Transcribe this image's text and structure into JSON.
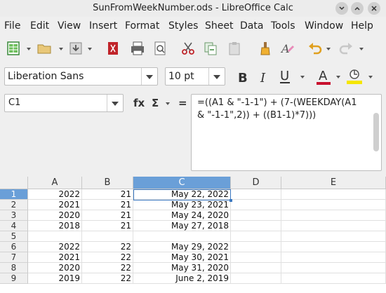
{
  "window": {
    "title": "SunFromWeekNumber.ods - LibreOffice Calc"
  },
  "menu": [
    "File",
    "Edit",
    "View",
    "Insert",
    "Format",
    "Styles",
    "Sheet",
    "Data",
    "Tools",
    "Window",
    "Help"
  ],
  "format": {
    "font_name": "Liberation Sans",
    "font_size": "10 pt"
  },
  "formula_bar": {
    "name_box": "C1",
    "fx_label": "fx",
    "sum_label": "Σ",
    "equals_label": "=",
    "formula": "=((A1 & \"-1-1\") + (7-(WEEKDAY(A1 & \"-1-1\",2)) + ((B1-1)*7)))"
  },
  "sheet": {
    "selected_cell": "C1",
    "columns": [
      "A",
      "B",
      "C",
      "D",
      "E"
    ],
    "rows": [
      {
        "num": "1",
        "a": "2022",
        "b": "21",
        "c": "May 22, 2022"
      },
      {
        "num": "2",
        "a": "2021",
        "b": "21",
        "c": "May 23, 2021"
      },
      {
        "num": "3",
        "a": "2020",
        "b": "21",
        "c": "May 24, 2020"
      },
      {
        "num": "4",
        "a": "2018",
        "b": "21",
        "c": "May 27, 2018"
      },
      {
        "num": "5",
        "a": "",
        "b": "",
        "c": ""
      },
      {
        "num": "6",
        "a": "2022",
        "b": "22",
        "c": "May 29, 2022"
      },
      {
        "num": "7",
        "a": "2021",
        "b": "22",
        "c": "May 30, 2021"
      },
      {
        "num": "8",
        "a": "2020",
        "b": "22",
        "c": "May 31, 2020"
      },
      {
        "num": "9",
        "a": "2019",
        "b": "22",
        "c": "June 2, 2019"
      }
    ]
  },
  "colors": {
    "selection": "#6a9fd8",
    "cursor": "#3b78c0",
    "font_color_bar": "#c8102e",
    "highlight_bar": "#f5e600"
  }
}
